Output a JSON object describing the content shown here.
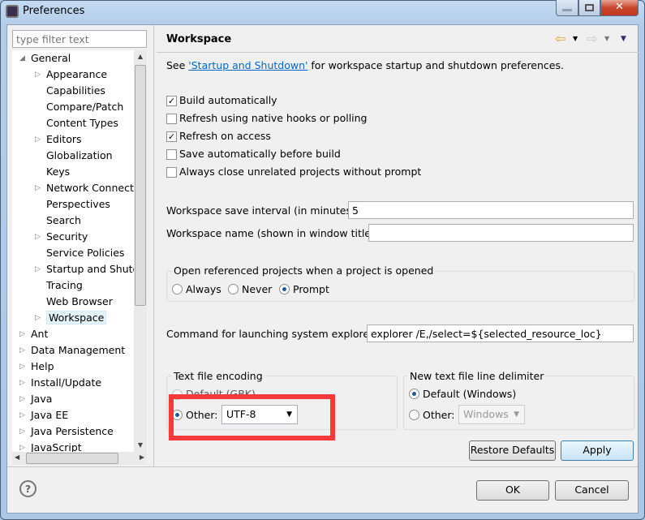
{
  "window": {
    "title": "Preferences"
  },
  "filter": {
    "placeholder": "type filter text"
  },
  "tree": [
    {
      "label": "General",
      "level": 0,
      "expander": "expanded"
    },
    {
      "label": "Appearance",
      "level": 1,
      "expander": "collapsed"
    },
    {
      "label": "Capabilities",
      "level": 1,
      "expander": "none"
    },
    {
      "label": "Compare/Patch",
      "level": 1,
      "expander": "none"
    },
    {
      "label": "Content Types",
      "level": 1,
      "expander": "none"
    },
    {
      "label": "Editors",
      "level": 1,
      "expander": "collapsed"
    },
    {
      "label": "Globalization",
      "level": 1,
      "expander": "none"
    },
    {
      "label": "Keys",
      "level": 1,
      "expander": "none"
    },
    {
      "label": "Network Connections",
      "level": 1,
      "expander": "collapsed"
    },
    {
      "label": "Perspectives",
      "level": 1,
      "expander": "none"
    },
    {
      "label": "Search",
      "level": 1,
      "expander": "none"
    },
    {
      "label": "Security",
      "level": 1,
      "expander": "collapsed"
    },
    {
      "label": "Service Policies",
      "level": 1,
      "expander": "none"
    },
    {
      "label": "Startup and Shutdown",
      "level": 1,
      "expander": "collapsed"
    },
    {
      "label": "Tracing",
      "level": 1,
      "expander": "none"
    },
    {
      "label": "Web Browser",
      "level": 1,
      "expander": "none"
    },
    {
      "label": "Workspace",
      "level": 1,
      "expander": "collapsed",
      "selected": true
    },
    {
      "label": "Ant",
      "level": 0,
      "expander": "collapsed"
    },
    {
      "label": "Data Management",
      "level": 0,
      "expander": "collapsed"
    },
    {
      "label": "Help",
      "level": 0,
      "expander": "collapsed"
    },
    {
      "label": "Install/Update",
      "level": 0,
      "expander": "collapsed"
    },
    {
      "label": "Java",
      "level": 0,
      "expander": "collapsed"
    },
    {
      "label": "Java EE",
      "level": 0,
      "expander": "collapsed"
    },
    {
      "label": "Java Persistence",
      "level": 0,
      "expander": "collapsed"
    },
    {
      "label": "JavaScript",
      "level": 0,
      "expander": "collapsed"
    }
  ],
  "page": {
    "title": "Workspace",
    "intro_pre": "See ",
    "intro_link": "'Startup and Shutdown'",
    "intro_post": " for workspace startup and shutdown preferences.",
    "checkboxes": [
      {
        "label": "Build automatically",
        "checked": true
      },
      {
        "label": "Refresh using native hooks or polling",
        "checked": false
      },
      {
        "label": "Refresh on access",
        "checked": true
      },
      {
        "label": "Save automatically before build",
        "checked": false
      },
      {
        "label": "Always close unrelated projects without prompt",
        "checked": false
      }
    ],
    "save_interval_label": "Workspace save interval (in minutes):",
    "save_interval_value": "5",
    "name_label": "Workspace name (shown in window title):",
    "name_value": "",
    "open_group": {
      "title": "Open referenced projects when a project is opened",
      "options": [
        "Always",
        "Never",
        "Prompt"
      ],
      "selected": "Prompt"
    },
    "explorer_label": "Command for launching system explorer:",
    "explorer_value": "explorer /E,/select=${selected_resource_loc}",
    "encoding": {
      "title": "Text file encoding",
      "default_label": "Default (GBK)",
      "other_label": "Other:",
      "other_value": "UTF-8",
      "selected": "other"
    },
    "delimiter": {
      "title": "New text file line delimiter",
      "default_label": "Default (Windows)",
      "other_label": "Other:",
      "other_value": "Windows",
      "selected": "default"
    },
    "restore_defaults": "Restore Defaults",
    "apply": "Apply"
  },
  "footer": {
    "ok": "OK",
    "cancel": "Cancel"
  },
  "annotation": {
    "color": "#f43a3a"
  }
}
